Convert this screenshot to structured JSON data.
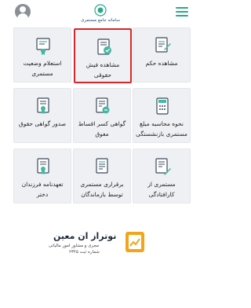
{
  "header": {
    "logo_text": "سامانه جامع مستمری",
    "avatar_icon": "user-icon",
    "menu_icon": "hamburger-menu-icon"
  },
  "tiles": [
    {
      "label": "مشاهده حکم",
      "icon": "ruling-document-icon"
    },
    {
      "label": "مشاهده فیش حقوقی",
      "icon": "payslip-icon",
      "highlighted": true
    },
    {
      "label": "استعلام وضعیت مستمری",
      "icon": "certificate-inquiry-icon"
    },
    {
      "label": "نحوه محاسبه مبلغ مستمری بازنشستگی",
      "icon": "calculation-icon"
    },
    {
      "label": "گواهی کسر اقساط معوق",
      "icon": "deduction-certificate-icon"
    },
    {
      "label": "صدور گواهی حقوق",
      "icon": "salary-certificate-icon"
    },
    {
      "label": "مستمری از کارافتادگی",
      "icon": "disability-pension-icon"
    },
    {
      "label": "برقراری مستمری توسط بازماندگان",
      "icon": "survivors-pension-icon"
    },
    {
      "label": "تعهدنامه فرزندان دختر",
      "icon": "commitment-letter-icon"
    }
  ],
  "footer": {
    "brand": "نوتراز ان معین",
    "subtitle": "مجری و مشاور امور مالیاتی",
    "registration": "شماره ثبت ۲۳۴۵"
  },
  "colors": {
    "accent": "#2aa98c",
    "highlight": "#d6262b",
    "tile_bg": "#eef0f3",
    "icon_dark": "#3c4a5e",
    "icon_teal": "#44b8a3"
  }
}
